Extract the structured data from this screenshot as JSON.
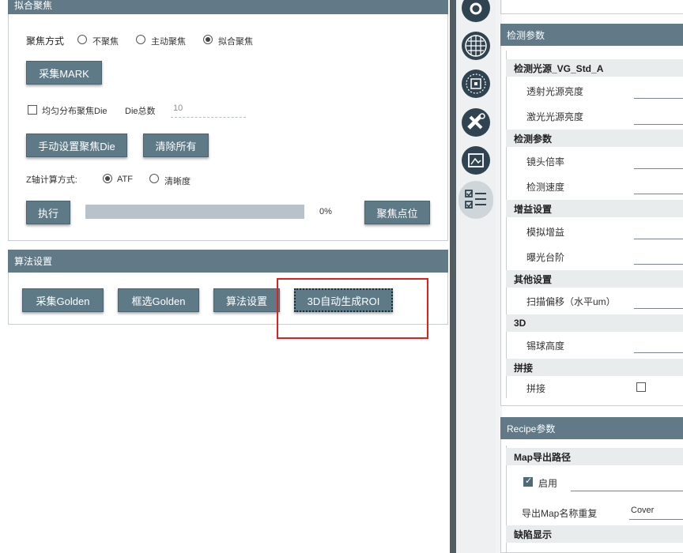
{
  "left": {
    "fit_focus_section": {
      "title": "拟合聚焦",
      "focus_mode_label": "聚焦方式",
      "focus_options": [
        {
          "label": "不聚焦",
          "selected": false
        },
        {
          "label": "主动聚焦",
          "selected": false
        },
        {
          "label": "拟合聚焦",
          "selected": true
        }
      ],
      "collect_mark_button": "采集MARK",
      "uniform_die_checkbox": {
        "label": "均匀分布聚焦Die",
        "checked": false
      },
      "die_total_label": "Die总数",
      "die_total_value": "10",
      "manual_set_button": "手动设置聚焦Die",
      "clear_all_button": "清除所有",
      "z_calc_label": "Z轴计算方式:",
      "z_options": [
        {
          "label": "ATF",
          "selected": true
        },
        {
          "label": "清晰度",
          "selected": false
        }
      ],
      "execute_button": "执行",
      "progress_text": "0%",
      "progress_value": 0,
      "focus_points_button": "聚焦点位"
    },
    "algo_section": {
      "title": "算法设置",
      "buttons": [
        "采集Golden",
        "框选Golden",
        "算法设置",
        "3D自动生成ROI"
      ]
    }
  },
  "toolbar": {
    "icons": [
      "circle-target-icon",
      "grid-sphere-icon",
      "chip-scan-icon",
      "tools-icon",
      "image-frame-icon",
      "checklist-icon"
    ]
  },
  "right": {
    "detect_params": {
      "title": "检测参数",
      "groups": [
        {
          "name": "检测光源_VG_Std_A",
          "items": [
            "透射光源亮度",
            "激光光源亮度"
          ]
        },
        {
          "name": "检测参数",
          "items": [
            "镜头倍率",
            "检测速度"
          ]
        },
        {
          "name": "增益设置",
          "items": [
            "模拟增益",
            "曝光台阶"
          ]
        },
        {
          "name": "其他设置",
          "items": [
            "扫描偏移（水平um）"
          ]
        },
        {
          "name": "3D",
          "items": [
            "锡球高度"
          ]
        },
        {
          "name": "拼接",
          "items": [
            "拼接"
          ]
        }
      ],
      "stitch_checked": false
    },
    "recipe_params": {
      "title": "Recipe参数",
      "map_path_group": "Map导出路径",
      "enable_label": "启用",
      "enable_checked": true,
      "map_name_repeat_label": "导出Map名称重复",
      "map_name_repeat_value": "Cover",
      "defect_display_group": "缺陷显示"
    }
  },
  "colors": {
    "panel_header": "#627a87",
    "button": "#5f7a87",
    "highlight_box": "#e02020",
    "toolbar_icon": "#2f4350",
    "divider": "#515c63"
  }
}
